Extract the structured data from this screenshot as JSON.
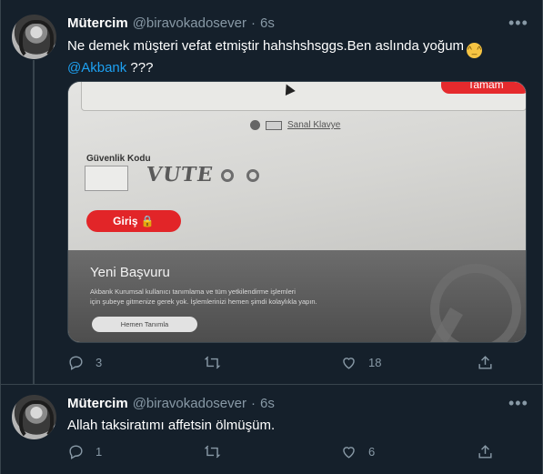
{
  "tweets": [
    {
      "author_name": "Mütercim",
      "handle": "@biravokadosever",
      "separator": "·",
      "time": "6s",
      "more_icon": "more-horizontal-icon",
      "text_part1": "Ne demek müşteri vefat etmiştir hahshshsggs.Ben aslında yoğum",
      "emoji": "grinning-sweat-emoji",
      "emoji_glyph": "^_^",
      "mention": "@Akbank",
      "text_part2": " ???",
      "media": {
        "tamam_label": "Tamam",
        "keyboard_label": "Sanal Klavye",
        "security_label": "Güvenlik Kodu",
        "captcha_text": "VUTE",
        "login_label": "Giriş",
        "login_icon": "lock-icon",
        "section_title": "Yeni Başvuru",
        "section_text_1": "Akbank Kurumsal kullanıcı tanımlama ve tüm yetkilendirme işlemleri",
        "section_text_2": "için şubeye gitmenize gerek yok. İşlemlerinizi hemen şimdi kolaylıkla yapın.",
        "section_button": "Hemen Tanımla"
      },
      "replies": "3",
      "retweets": "",
      "likes": "18"
    },
    {
      "author_name": "Mütercim",
      "handle": "@biravokadosever",
      "separator": "·",
      "time": "6s",
      "text": "Allah taksiratımı affetsin ölmüşüm.",
      "replies": "1",
      "retweets": "",
      "likes": "6"
    }
  ],
  "colors": {
    "background": "#15202b",
    "border": "#38444d",
    "secondary_text": "#8899a6",
    "mention": "#1da1f2",
    "akbank_red": "#e52a2d"
  }
}
